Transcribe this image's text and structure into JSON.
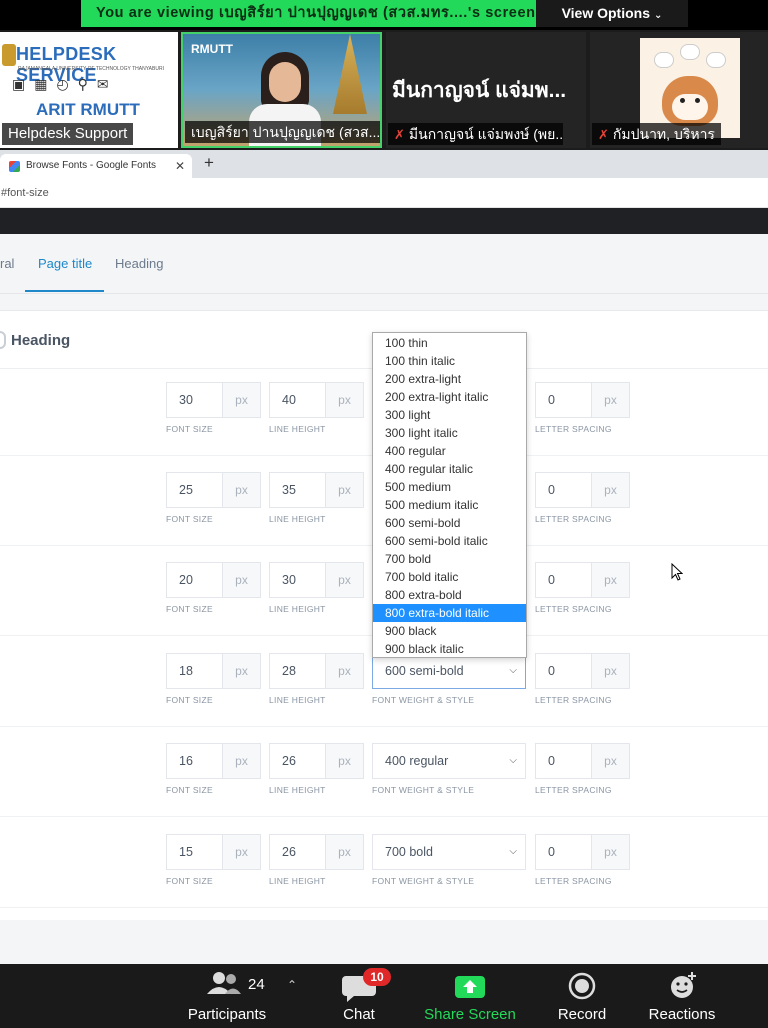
{
  "banner": {
    "viewing_text": "You are viewing เบญสิร์ยา ปานปุญญเดช (สวส.มทร....'s screen",
    "view_options_label": "View Options"
  },
  "participants_strip": {
    "tiles": [
      {
        "name": "Helpdesk Support",
        "muted": false,
        "content_title": "HELPDESK SERVICE",
        "content_subtitle": "RAJAMANGALA UNIVERSITY OF TECHNOLOGY THANYABURI",
        "content_bottom": "ARIT RMUTT",
        "content_service": "Service"
      },
      {
        "name": "เบญสิร์ยา ปานปุญญเดช (สวส....",
        "muted": false,
        "logo_text": "RMUTT"
      },
      {
        "name": "มีนกาญจน์ แจ่มพงษ์ (พย....",
        "muted": true,
        "display_name": "มีนกาญจน์ แจ่มพ..."
      },
      {
        "name": "กัมปนาท, บริหาร",
        "muted": true
      }
    ]
  },
  "browser": {
    "tab_title": "Browse Fonts - Google Fonts",
    "address_fragment": "#font-size"
  },
  "page": {
    "subtabs": [
      {
        "label": "ral",
        "active": false
      },
      {
        "label": "Page title",
        "active": true
      },
      {
        "label": "Heading",
        "active": false
      }
    ],
    "section_title": "Heading",
    "labels": {
      "font_size": "FONT SIZE",
      "line_height": "LINE HEIGHT",
      "font_weight": "FONT WEIGHT & STYLE",
      "letter_spacing": "LETTER SPACING",
      "unit": "px"
    },
    "rows": [
      {
        "font_size": "30",
        "line_height": "40",
        "weight": "",
        "letter_spacing": "0"
      },
      {
        "font_size": "25",
        "line_height": "35",
        "weight": "",
        "letter_spacing": "0"
      },
      {
        "font_size": "20",
        "line_height": "30",
        "weight": "",
        "letter_spacing": "0"
      },
      {
        "font_size": "18",
        "line_height": "28",
        "weight": "600 semi-bold",
        "letter_spacing": "0"
      },
      {
        "font_size": "16",
        "line_height": "26",
        "weight": "400 regular",
        "letter_spacing": "0"
      },
      {
        "font_size": "15",
        "line_height": "26",
        "weight": "700 bold",
        "letter_spacing": "0"
      }
    ],
    "dropdown_options": [
      "100 thin",
      "100 thin italic",
      "200 extra-light",
      "200 extra-light italic",
      "300 light",
      "300 light italic",
      "400 regular",
      "400 regular italic",
      "500 medium",
      "500 medium italic",
      "600 semi-bold",
      "600 semi-bold italic",
      "700 bold",
      "700 bold italic",
      "800 extra-bold",
      "800 extra-bold italic",
      "900 black",
      "900 black italic"
    ],
    "dropdown_highlighted": "800 extra-bold italic"
  },
  "zoom_toolbar": {
    "participants_label": "Participants",
    "participants_count": "24",
    "chat_label": "Chat",
    "chat_badge": "10",
    "share_label": "Share Screen",
    "record_label": "Record",
    "reactions_label": "Reactions",
    "share_color": "#23d959",
    "badge_color": "#e02828"
  }
}
